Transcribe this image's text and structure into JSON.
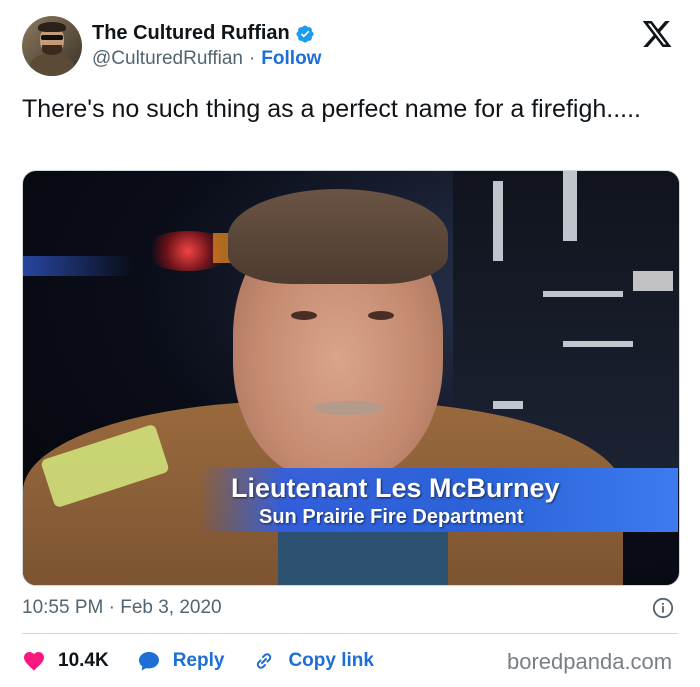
{
  "author": {
    "display_name": "The Cultured Ruffian",
    "handle": "@CulturedRuffian",
    "separator": "·",
    "follow_label": "Follow"
  },
  "tweet": {
    "text": "There's no such thing as a perfect name for a firefigh.....",
    "media": {
      "caption_name": "Lieutenant Les McBurney",
      "caption_department": "Sun Prairie Fire Department"
    },
    "timestamp": "10:55 PM · Feb 3, 2020"
  },
  "actions": {
    "likes_count": "10.4K",
    "reply_label": "Reply",
    "copy_link_label": "Copy link"
  },
  "watermark": "boredpanda.com",
  "colors": {
    "accent": "#1d9bf0",
    "link": "#1d6fd6",
    "like": "#f91880",
    "text": "#0f1419",
    "muted": "#536471"
  },
  "icons": [
    "verified-badge-icon",
    "x-logo-icon",
    "info-icon",
    "heart-icon",
    "reply-icon",
    "link-icon"
  ]
}
